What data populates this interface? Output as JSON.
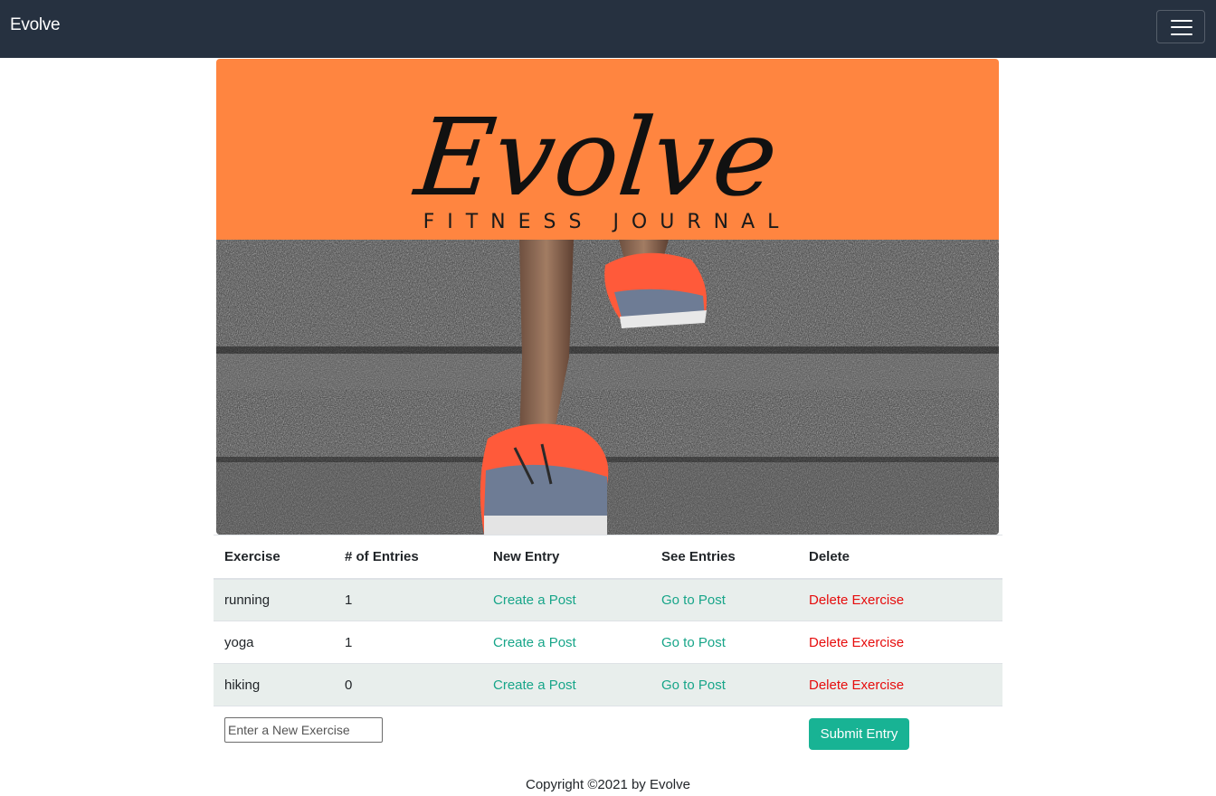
{
  "navbar": {
    "brand": "Evolve"
  },
  "hero": {
    "logo_script": "Evolve",
    "tagline": "FITNESS JOURNAL",
    "banner_color": "#ff8540"
  },
  "table": {
    "headers": [
      "Exercise",
      "# of Entries",
      "New Entry",
      "See Entries",
      "Delete"
    ],
    "rows": [
      {
        "exercise": "running",
        "entries": "1",
        "new_entry": "Create a Post",
        "see_entries": "Go to Post",
        "delete": "Delete Exercise"
      },
      {
        "exercise": "yoga",
        "entries": "1",
        "new_entry": "Create a Post",
        "see_entries": "Go to Post",
        "delete": "Delete Exercise"
      },
      {
        "exercise": "hiking",
        "entries": "0",
        "new_entry": "Create a Post",
        "see_entries": "Go to Post",
        "delete": "Delete Exercise"
      }
    ]
  },
  "form": {
    "placeholder": "Enter a New Exercise",
    "value": "",
    "submit_label": "Submit Entry"
  },
  "footer": {
    "copyright": "Copyright ©2021 by Evolve"
  },
  "colors": {
    "navbar": "#263140",
    "link_green": "#17a589",
    "link_red": "#e60c0c",
    "button": "#18b394"
  }
}
